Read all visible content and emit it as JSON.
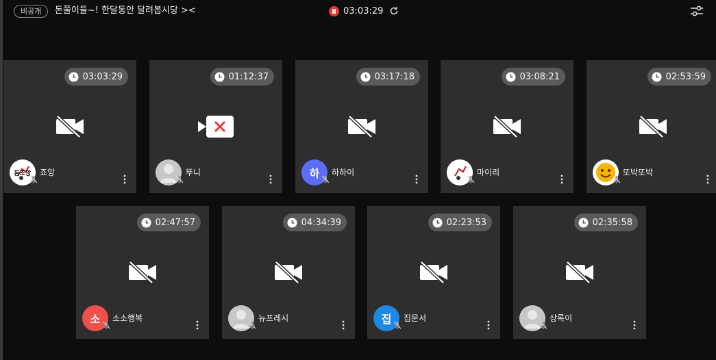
{
  "header": {
    "visibility_badge": "비공개",
    "room_title": "돈쭐이들~! 한달동안 달려봅시당 ><",
    "recording_time": "03:03:29"
  },
  "colors": {
    "background": "#0d0d0d",
    "tile": "#2e2e2e",
    "timer": "#5a5a5a",
    "record": "#e53935"
  },
  "participants": [
    {
      "name": "죠앙",
      "timer": "03:03:29",
      "avatar_type": "image",
      "avatar_text": "돈조앙",
      "avatar_color": "#ffffff",
      "camera": "off"
    },
    {
      "name": "뚜니",
      "timer": "01:12:37",
      "avatar_type": "default",
      "avatar_text": "",
      "avatar_color": "#c7c7c7",
      "camera": "error"
    },
    {
      "name": "하하이",
      "timer": "03:17:18",
      "avatar_type": "letter",
      "avatar_text": "하",
      "avatar_color": "#5b6ef5",
      "camera": "off"
    },
    {
      "name": "마이리",
      "timer": "03:08:21",
      "avatar_type": "image",
      "avatar_text": "",
      "avatar_color": "#ffffff",
      "camera": "off"
    },
    {
      "name": "또박또박",
      "timer": "02:53:59",
      "avatar_type": "smiley",
      "avatar_text": "",
      "avatar_color": "#f7b500",
      "camera": "off"
    },
    {
      "name": "소소행복",
      "timer": "02:47:57",
      "avatar_type": "letter",
      "avatar_text": "소",
      "avatar_color": "#f0504a",
      "camera": "off"
    },
    {
      "name": "뉴프레시",
      "timer": "04:34:39",
      "avatar_type": "default",
      "avatar_text": "",
      "avatar_color": "#c7c7c7",
      "camera": "off"
    },
    {
      "name": "집문서",
      "timer": "02:23:53",
      "avatar_type": "letter",
      "avatar_text": "집",
      "avatar_color": "#1e88e5",
      "camera": "off"
    },
    {
      "name": "상록이",
      "timer": "02:35:58",
      "avatar_type": "default",
      "avatar_text": "",
      "avatar_color": "#c7c7c7",
      "camera": "off"
    }
  ]
}
